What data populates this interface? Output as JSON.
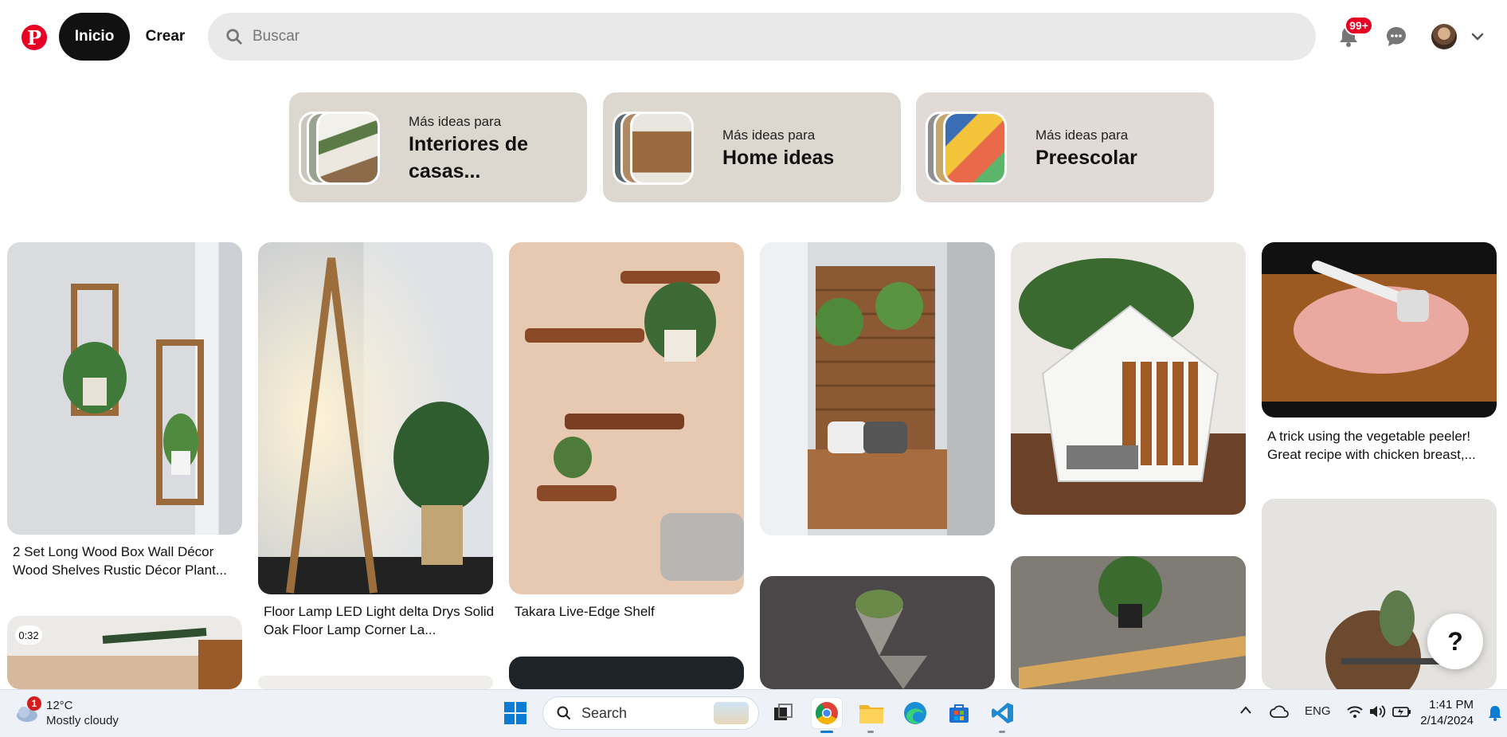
{
  "header": {
    "logo_glyph": "P",
    "home_label": "Inicio",
    "create_label": "Crear",
    "search_placeholder": "Buscar",
    "notifications_badge": "99+"
  },
  "ideas": [
    {
      "small": "Más ideas para",
      "big": "Interiores de casas..."
    },
    {
      "small": "Más ideas para",
      "big": "Home ideas"
    },
    {
      "small": "Más ideas para",
      "big": "Preescolar"
    }
  ],
  "pins": {
    "p1_title": "2 Set Long Wood Box Wall Décor Wood Shelves Rustic Décor Plant...",
    "p2_title": "Floor Lamp LED Light delta Drys Solid Oak Floor Lamp Corner La...",
    "p3_title": "Takara Live-Edge Shelf",
    "p6_title": "A trick using the vegetable peeler! Great recipe with chicken breast,...",
    "video_duration": "0:32"
  },
  "help_label": "?",
  "taskbar": {
    "weather_temp": "12°C",
    "weather_desc": "Mostly cloudy",
    "weather_badge": "1",
    "search_label": "Search",
    "lang": "ENG",
    "time": "1:41 PM",
    "date": "2/14/2024"
  },
  "colors": {
    "brand": "#e60023",
    "accent_blue": "#0b7bd4"
  }
}
